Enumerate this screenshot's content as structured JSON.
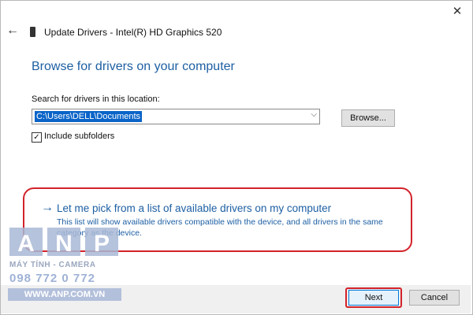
{
  "window": {
    "title": "Update Drivers - Intel(R) HD Graphics 520",
    "close_glyph": "✕",
    "back_glyph": "←"
  },
  "main": {
    "heading": "Browse for drivers on your computer",
    "search_label": "Search for drivers in this location:",
    "path_value": "C:\\Users\\DELL\\Documents",
    "browse_label": "Browse...",
    "include_subfolders": {
      "label": "Include subfolders",
      "checked": true,
      "check_glyph": "✓"
    },
    "pick_option": {
      "arrow_glyph": "→",
      "title": "Let me pick from a list of available drivers on my computer",
      "description": "This list will show available drivers compatible with the device, and all drivers in the same category as the device."
    }
  },
  "footer": {
    "next_label": "Next",
    "cancel_label": "Cancel"
  },
  "watermark": {
    "logo_letters": "ANP",
    "tagline": "MÁY TÍNH - CAMERA",
    "phone": "098 772 0 772",
    "website": "WWW.ANP.COM.VN"
  },
  "colors": {
    "link_blue": "#1d5fa3",
    "selection_blue": "#0a64c8",
    "annotation_red": "#d2232a",
    "footer_gray": "#f0f0f0"
  },
  "icons": {
    "device": "device-icon",
    "back": "back-arrow-icon",
    "close": "close-icon",
    "dropdown": "chevron-down-icon",
    "pick": "arrow-right-icon"
  }
}
